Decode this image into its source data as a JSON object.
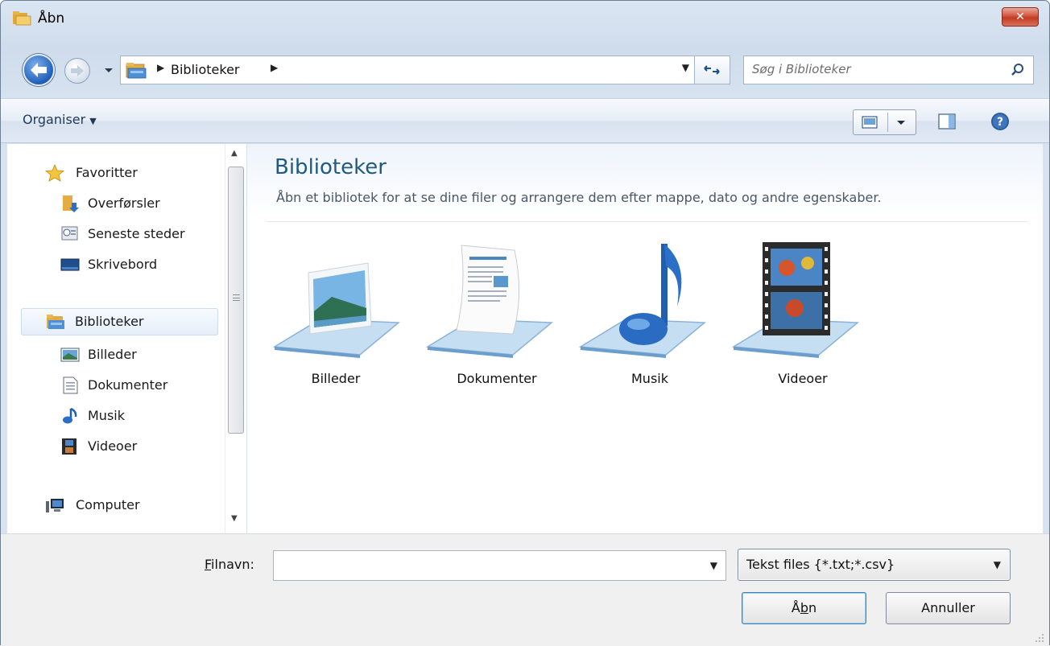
{
  "window": {
    "title": "Åbn",
    "close_label": "✕"
  },
  "address_bar": {
    "breadcrumb": "Biblioteker",
    "search_placeholder": "Søg i Biblioteker"
  },
  "toolbar": {
    "organise_label": "Organiser"
  },
  "nav_pane": {
    "favorites": {
      "label": "Favoritter",
      "icon": "star-icon"
    },
    "favorite_items": [
      {
        "label": "Overførsler",
        "icon": "downloads-icon"
      },
      {
        "label": "Seneste steder",
        "icon": "recent-places-icon"
      },
      {
        "label": "Skrivebord",
        "icon": "desktop-icon"
      }
    ],
    "libraries": {
      "label": "Biblioteker",
      "icon": "libraries-icon"
    },
    "library_items": [
      {
        "label": "Billeder",
        "icon": "pictures-icon"
      },
      {
        "label": "Dokumenter",
        "icon": "documents-icon"
      },
      {
        "label": "Musik",
        "icon": "music-icon"
      },
      {
        "label": "Videoer",
        "icon": "videos-icon"
      }
    ],
    "computer": {
      "label": "Computer",
      "icon": "computer-icon"
    }
  },
  "content": {
    "title": "Biblioteker",
    "description": "Åbn et bibliotek for at se dine filer og arrangere dem efter mappe, dato og andre egenskaber.",
    "libraries": [
      {
        "label": "Billeder",
        "icon": "pictures-library-icon"
      },
      {
        "label": "Dokumenter",
        "icon": "documents-library-icon"
      },
      {
        "label": "Musik",
        "icon": "music-library-icon"
      },
      {
        "label": "Videoer",
        "icon": "videos-library-icon"
      }
    ]
  },
  "footer": {
    "filename_label_accel": "F",
    "filename_label_rest": "ilnavn:",
    "filename_value": "",
    "file_type": "Tekst files {*.txt;*.csv}",
    "open_pre": "Å",
    "open_accel": "b",
    "open_post": "n",
    "cancel_label": "Annuller"
  }
}
